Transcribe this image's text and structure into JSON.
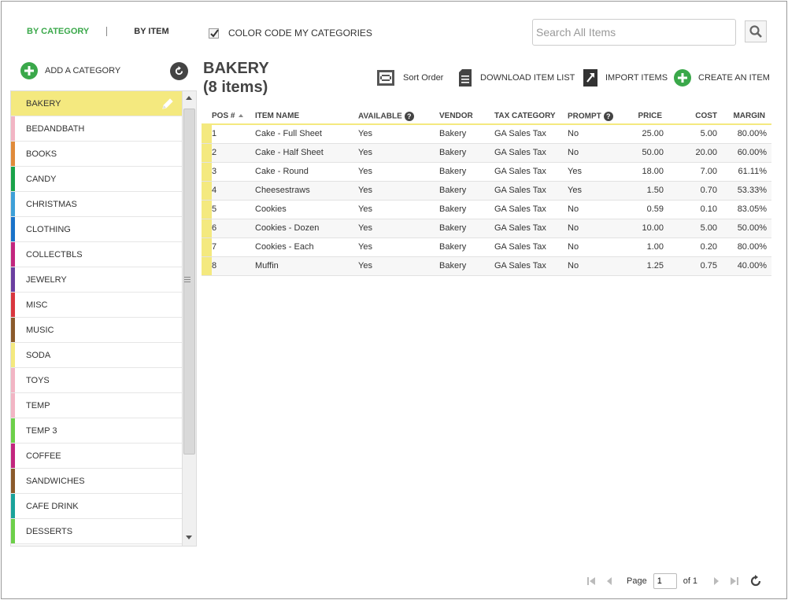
{
  "header": {
    "tab_by_category": "BY CATEGORY",
    "tab_by_item": "BY ITEM",
    "color_code_label": "COLOR CODE MY CATEGORIES",
    "color_code_checked": true,
    "search_placeholder": "Search All Items",
    "accent_color": "#3aa84a"
  },
  "sidebar": {
    "add_category_label": "ADD A CATEGORY",
    "categories": [
      {
        "label": "BAKERY",
        "color": "#f4e97f",
        "selected": true
      },
      {
        "label": "BEDANDBATH",
        "color": "#f2b5c4"
      },
      {
        "label": "BOOKS",
        "color": "#e08a3a"
      },
      {
        "label": "CANDY",
        "color": "#1aa34a"
      },
      {
        "label": "CHRISTMAS",
        "color": "#3ea0d8"
      },
      {
        "label": "CLOTHING",
        "color": "#1a73c9"
      },
      {
        "label": "COLLECTBLS",
        "color": "#c2267e"
      },
      {
        "label": "JEWELRY",
        "color": "#6b3fa0"
      },
      {
        "label": "MISC",
        "color": "#d9363e"
      },
      {
        "label": "MUSIC",
        "color": "#8b5a2b"
      },
      {
        "label": "SODA",
        "color": "#f4e97f"
      },
      {
        "label": "TOYS",
        "color": "#f2b5c4"
      },
      {
        "label": "TEMP",
        "color": "#f2b5c4"
      },
      {
        "label": "TEMP 3",
        "color": "#6dcf4a"
      },
      {
        "label": "COFFEE",
        "color": "#c2267e"
      },
      {
        "label": "SANDWICHES",
        "color": "#8b5a2b"
      },
      {
        "label": "CAFE DRINK",
        "color": "#1aa39a"
      },
      {
        "label": "DESSERTS",
        "color": "#6dcf4a"
      }
    ]
  },
  "main": {
    "title": "BAKERY",
    "subtitle": "(8 items)",
    "toolbar": {
      "sort_order": "Sort Order",
      "download": "DOWNLOAD ITEM LIST",
      "import": "IMPORT ITEMS",
      "create": "CREATE AN ITEM"
    },
    "columns": {
      "pos": "POS #",
      "item_name": "ITEM NAME",
      "available": "AVAILABLE",
      "vendor": "VENDOR",
      "tax_category": "TAX CATEGORY",
      "prompt": "PROMPT",
      "price": "PRICE",
      "cost": "COST",
      "margin": "MARGIN"
    },
    "rows": [
      {
        "pos": "1",
        "name": "Cake - Full Sheet",
        "available": "Yes",
        "vendor": "Bakery",
        "tax": "GA Sales Tax",
        "prompt": "No",
        "price": "25.00",
        "cost": "5.00",
        "margin": "80.00%"
      },
      {
        "pos": "2",
        "name": "Cake - Half Sheet",
        "available": "Yes",
        "vendor": "Bakery",
        "tax": "GA Sales Tax",
        "prompt": "No",
        "price": "50.00",
        "cost": "20.00",
        "margin": "60.00%"
      },
      {
        "pos": "3",
        "name": "Cake - Round",
        "available": "Yes",
        "vendor": "Bakery",
        "tax": "GA Sales Tax",
        "prompt": "Yes",
        "price": "18.00",
        "cost": "7.00",
        "margin": "61.11%"
      },
      {
        "pos": "4",
        "name": "Cheesestraws",
        "available": "Yes",
        "vendor": "Bakery",
        "tax": "GA Sales Tax",
        "prompt": "Yes",
        "price": "1.50",
        "cost": "0.70",
        "margin": "53.33%"
      },
      {
        "pos": "5",
        "name": "Cookies",
        "available": "Yes",
        "vendor": "Bakery",
        "tax": "GA Sales Tax",
        "prompt": "No",
        "price": "0.59",
        "cost": "0.10",
        "margin": "83.05%"
      },
      {
        "pos": "6",
        "name": "Cookies - Dozen",
        "available": "Yes",
        "vendor": "Bakery",
        "tax": "GA Sales Tax",
        "prompt": "No",
        "price": "10.00",
        "cost": "5.00",
        "margin": "50.00%"
      },
      {
        "pos": "7",
        "name": "Cookies - Each",
        "available": "Yes",
        "vendor": "Bakery",
        "tax": "GA Sales Tax",
        "prompt": "No",
        "price": "1.00",
        "cost": "0.20",
        "margin": "80.00%"
      },
      {
        "pos": "8",
        "name": "Muffin",
        "available": "Yes",
        "vendor": "Bakery",
        "tax": "GA Sales Tax",
        "prompt": "No",
        "price": "1.25",
        "cost": "0.75",
        "margin": "40.00%"
      }
    ]
  },
  "pager": {
    "page_label": "Page",
    "page_value": "1",
    "of_label": "of 1"
  }
}
